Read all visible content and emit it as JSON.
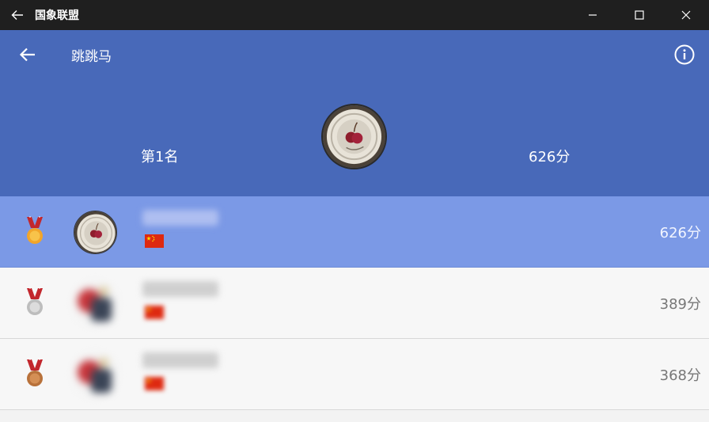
{
  "window": {
    "title": "国象联盟"
  },
  "header": {
    "title": "跳跳马",
    "rank_label": "第1名",
    "score_label": "626分"
  },
  "ranking": [
    {
      "medal": "gold-medal-icon",
      "score": "626分",
      "flag": "china-flag",
      "highlight": true
    },
    {
      "medal": "silver-medal-icon",
      "score": "389分",
      "flag": "china-flag",
      "highlight": false
    },
    {
      "medal": "bronze-medal-icon",
      "score": "368分",
      "flag": "china-flag",
      "highlight": false
    }
  ],
  "colors": {
    "titlebar": "#1f1f1f",
    "header": "#4869b9",
    "highlight_row": "#7b99e6",
    "row": "#f7f7f7",
    "gold": "#f2a52a",
    "silver": "#c7c7c7",
    "bronze": "#b8713a",
    "ribbon": "#c2272d"
  }
}
